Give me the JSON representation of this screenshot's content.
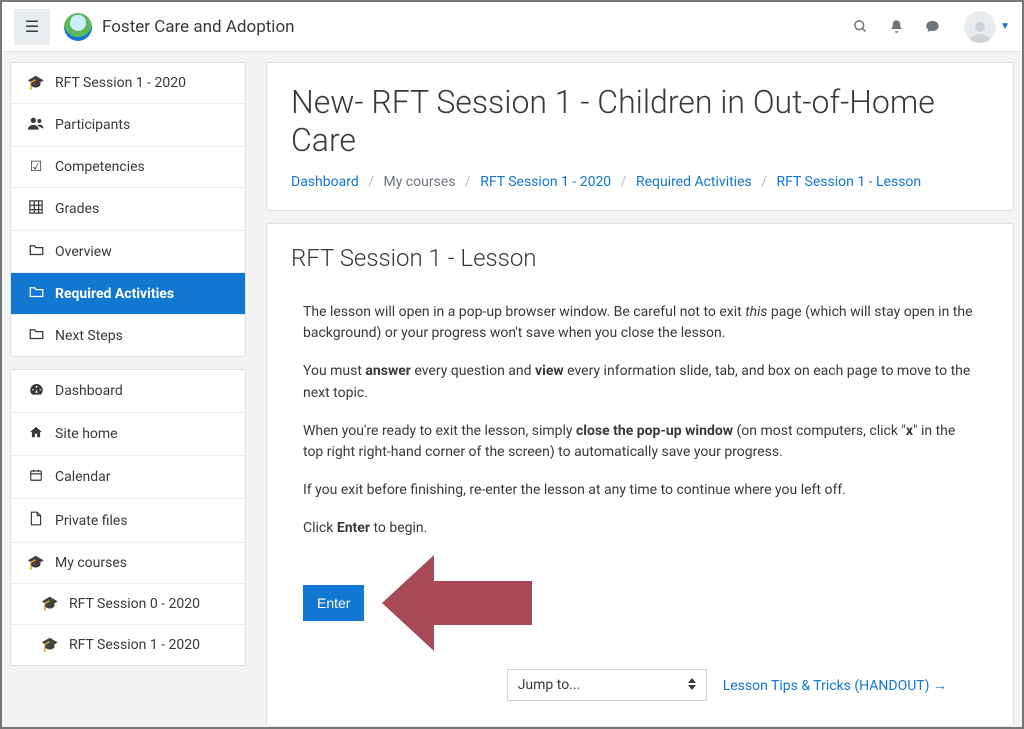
{
  "navbar": {
    "site_title": "Foster Care and Adoption"
  },
  "sidebar": {
    "block1": [
      {
        "icon": "🎓",
        "label": "RFT Session 1 - 2020"
      },
      {
        "icon": "👥",
        "label": "Participants"
      },
      {
        "icon": "☑",
        "label": "Competencies"
      },
      {
        "icon": "▦",
        "label": "Grades"
      },
      {
        "icon": "🗀",
        "label": "Overview"
      },
      {
        "icon": "🗀",
        "label": "Required Activities"
      },
      {
        "icon": "🗀",
        "label": "Next Steps"
      }
    ],
    "block2": [
      {
        "icon": "⌬",
        "label": "Dashboard"
      },
      {
        "icon": "⌂",
        "label": "Site home"
      },
      {
        "icon": "🗓",
        "label": "Calendar"
      },
      {
        "icon": "🗎",
        "label": "Private files"
      },
      {
        "icon": "🎓",
        "label": "My courses"
      },
      {
        "icon": "🎓",
        "label": "RFT Session 0 - 2020",
        "sub": true
      },
      {
        "icon": "🎓",
        "label": "RFT Session 1 - 2020",
        "sub": true
      }
    ]
  },
  "header": {
    "page_title": "New- RFT Session 1 - Children in Out-of-Home Care",
    "breadcrumbs": {
      "dashboard": "Dashboard",
      "mycourses": "My courses",
      "course": "RFT Session 1 - 2020",
      "section": "Required Activities",
      "page": "RFT Session 1 - Lesson"
    }
  },
  "lesson": {
    "title": "RFT Session 1 - Lesson",
    "p1_a": "The lesson will open in a pop-up browser window. Be careful not to exit ",
    "p1_em": "this",
    "p1_b": " page (which will stay open in the background) or your progress won't save when you close the lesson.",
    "p2_a": "You must ",
    "p2_s1": "answer",
    "p2_b": " every question and ",
    "p2_s2": "view",
    "p2_c": " every information slide, tab, and box on each page to move to the next topic.",
    "p3_a": "When you're ready to exit the lesson, simply ",
    "p3_s1": "close the pop-up window",
    "p3_b": " (on most computers, click \"",
    "p3_s2": "x",
    "p3_c": "\" in the top right right-hand corner of the screen) to automatically save your progress.",
    "p4": "If you exit before finishing, re-enter the lesson at any time to continue where you left off.",
    "p5_a": "Click ",
    "p5_s": "Enter",
    "p5_b": " to begin.",
    "enter_label": "Enter",
    "jump_label": "Jump to...",
    "next_link": "Lesson Tips & Tricks (HANDOUT) →"
  },
  "colors": {
    "accent": "#1177d1",
    "arrow": "#a84a56"
  }
}
